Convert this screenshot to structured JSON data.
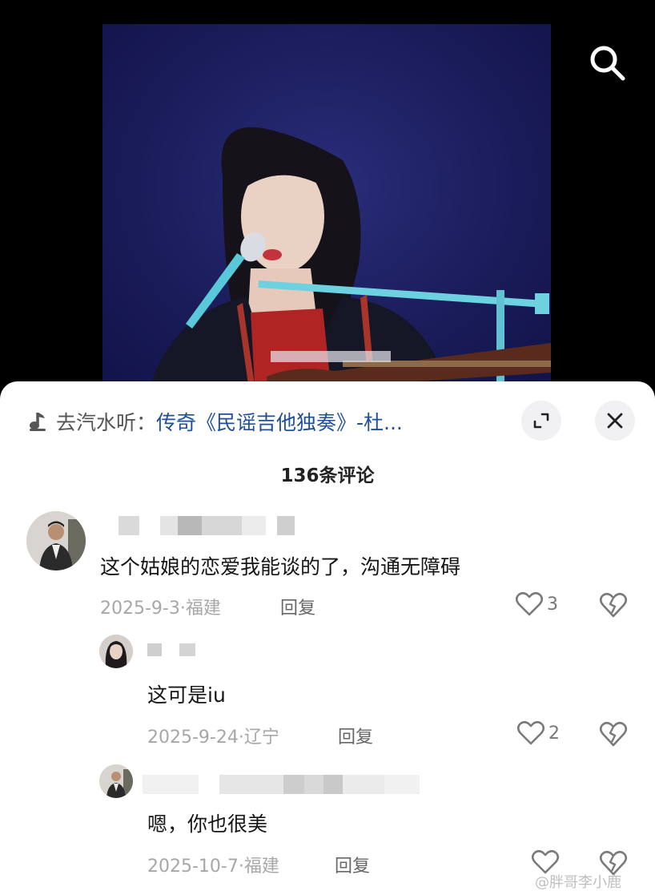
{
  "music": {
    "prefix": "去汽水听：",
    "title": "传奇《民谣吉他独奏》-杜..."
  },
  "comments_header": {
    "count_label": "136条评论"
  },
  "comments": [
    {
      "text": "这个姑娘的恋爱我能谈的了，沟通无障碍",
      "date_location": "2025-9-3·福建",
      "reply_label": "回复",
      "like_count": "3"
    }
  ],
  "replies": [
    {
      "text": "这可是iu",
      "date_location": "2025-9-24·辽宁",
      "reply_label": "回复",
      "like_count": "2"
    },
    {
      "text": "嗯，你也很美",
      "date_location": "2025-10-7·福建",
      "reply_label": "回复",
      "like_count": ""
    }
  ],
  "watermark": "@胖哥李小鹿",
  "colors": {
    "stage_background": "#1b1d5c",
    "sheet_background": "#ffffff",
    "music_title": "#1f4f98",
    "meta_gray": "#a7a7a7"
  },
  "icons": [
    "search-icon",
    "music-note-icon",
    "expand-icon",
    "close-icon",
    "heart-outline-icon",
    "broken-heart-icon"
  ]
}
